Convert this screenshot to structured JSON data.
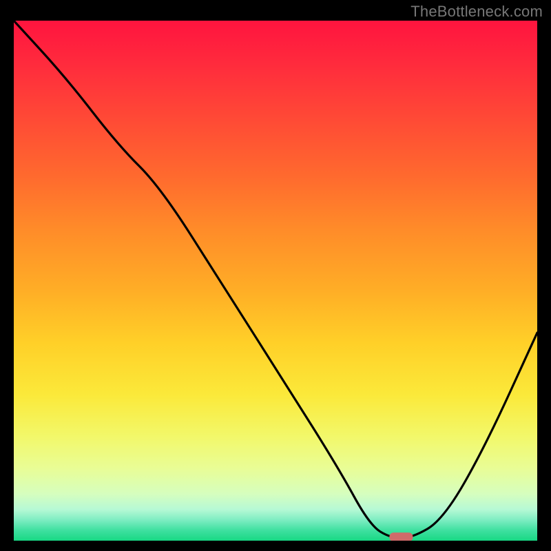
{
  "watermark": "TheBottleneck.com",
  "chart_data": {
    "type": "line",
    "title": "",
    "xlabel": "",
    "ylabel": "",
    "xlim": [
      0,
      100
    ],
    "ylim": [
      0,
      100
    ],
    "grid": false,
    "series": [
      {
        "name": "curve",
        "x": [
          0,
          10,
          20,
          28,
          40,
          52,
          62,
          68,
          72,
          76,
          82,
          90,
          100
        ],
        "values": [
          100,
          89,
          76,
          68,
          49,
          30,
          14,
          3,
          0.5,
          0.5,
          4,
          18,
          40
        ]
      }
    ],
    "marker": {
      "x": 74,
      "y": 0.7,
      "color": "#d06a6a"
    },
    "gradient_stops": [
      {
        "pos": 0,
        "color": "#ff143e"
      },
      {
        "pos": 8,
        "color": "#ff2a3d"
      },
      {
        "pos": 18,
        "color": "#ff4736"
      },
      {
        "pos": 30,
        "color": "#ff6a2e"
      },
      {
        "pos": 40,
        "color": "#ff8b29"
      },
      {
        "pos": 52,
        "color": "#ffae26"
      },
      {
        "pos": 62,
        "color": "#ffd028"
      },
      {
        "pos": 72,
        "color": "#fbe93a"
      },
      {
        "pos": 80,
        "color": "#f2f86a"
      },
      {
        "pos": 86,
        "color": "#e9fd95"
      },
      {
        "pos": 91,
        "color": "#d6febe"
      },
      {
        "pos": 94,
        "color": "#b6f9d5"
      },
      {
        "pos": 96,
        "color": "#7eedc2"
      },
      {
        "pos": 98,
        "color": "#3fe0a0"
      },
      {
        "pos": 100,
        "color": "#18d884"
      }
    ]
  }
}
